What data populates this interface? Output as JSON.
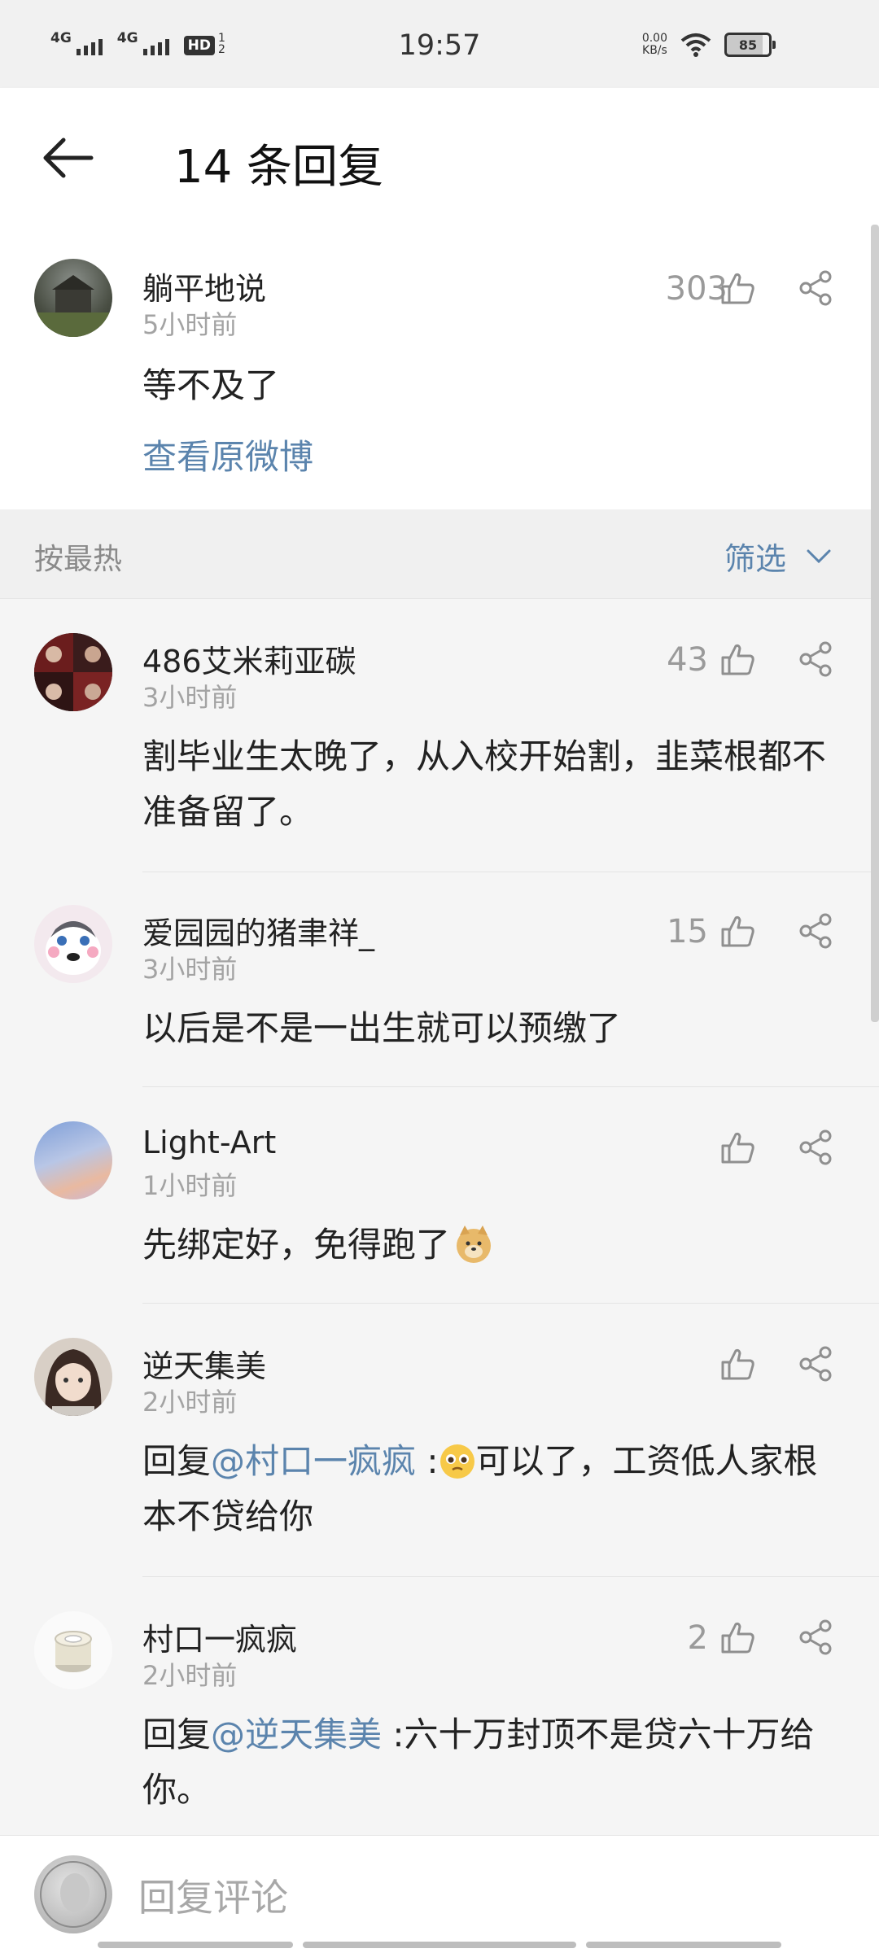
{
  "status_bar": {
    "time": "19:57",
    "net1": "4G",
    "net2": "4G",
    "hd": "HD",
    "hd_sub": "1 2",
    "speed_value": "0.00",
    "speed_unit": "KB/s",
    "battery": "85"
  },
  "header": {
    "title": "14 条回复"
  },
  "main_comment": {
    "user": "躺平地说",
    "time": "5小时前",
    "likes": "303",
    "text": "等不及了",
    "view_original": "查看原微博"
  },
  "sort": {
    "label": "按最热",
    "filter_label": "筛选"
  },
  "comments": [
    {
      "user": "486艾米莉亚碳",
      "time": "3小时前",
      "likes": "43",
      "text": "割毕业生太晚了，从入校开始割，韭菜根都不准备留了。"
    },
    {
      "user": "爱园园的猪聿祥_",
      "time": "3小时前",
      "likes": "15",
      "text": "以后是不是一出生就可以预缴了"
    },
    {
      "user": "Light-Art",
      "time": "1小时前",
      "likes": "",
      "text": "先绑定好，免得跑了"
    },
    {
      "user": "逆天集美",
      "time": "2小时前",
      "likes": "",
      "text_prefix": "回复",
      "mention": "@村口一疯疯",
      "text": " :可以了，工资低人家根本不贷给你"
    },
    {
      "user": "村口一疯疯",
      "time": "2小时前",
      "likes": "2",
      "text_prefix": "回复",
      "mention": "@逆天集美",
      "text": " :六十万封顶不是贷六十万给你。"
    }
  ],
  "reply_bar": {
    "placeholder": "回复评论"
  },
  "colors": {
    "link": "#5b84ad",
    "muted": "#a3a3a3",
    "background": "#f5f5f5"
  }
}
